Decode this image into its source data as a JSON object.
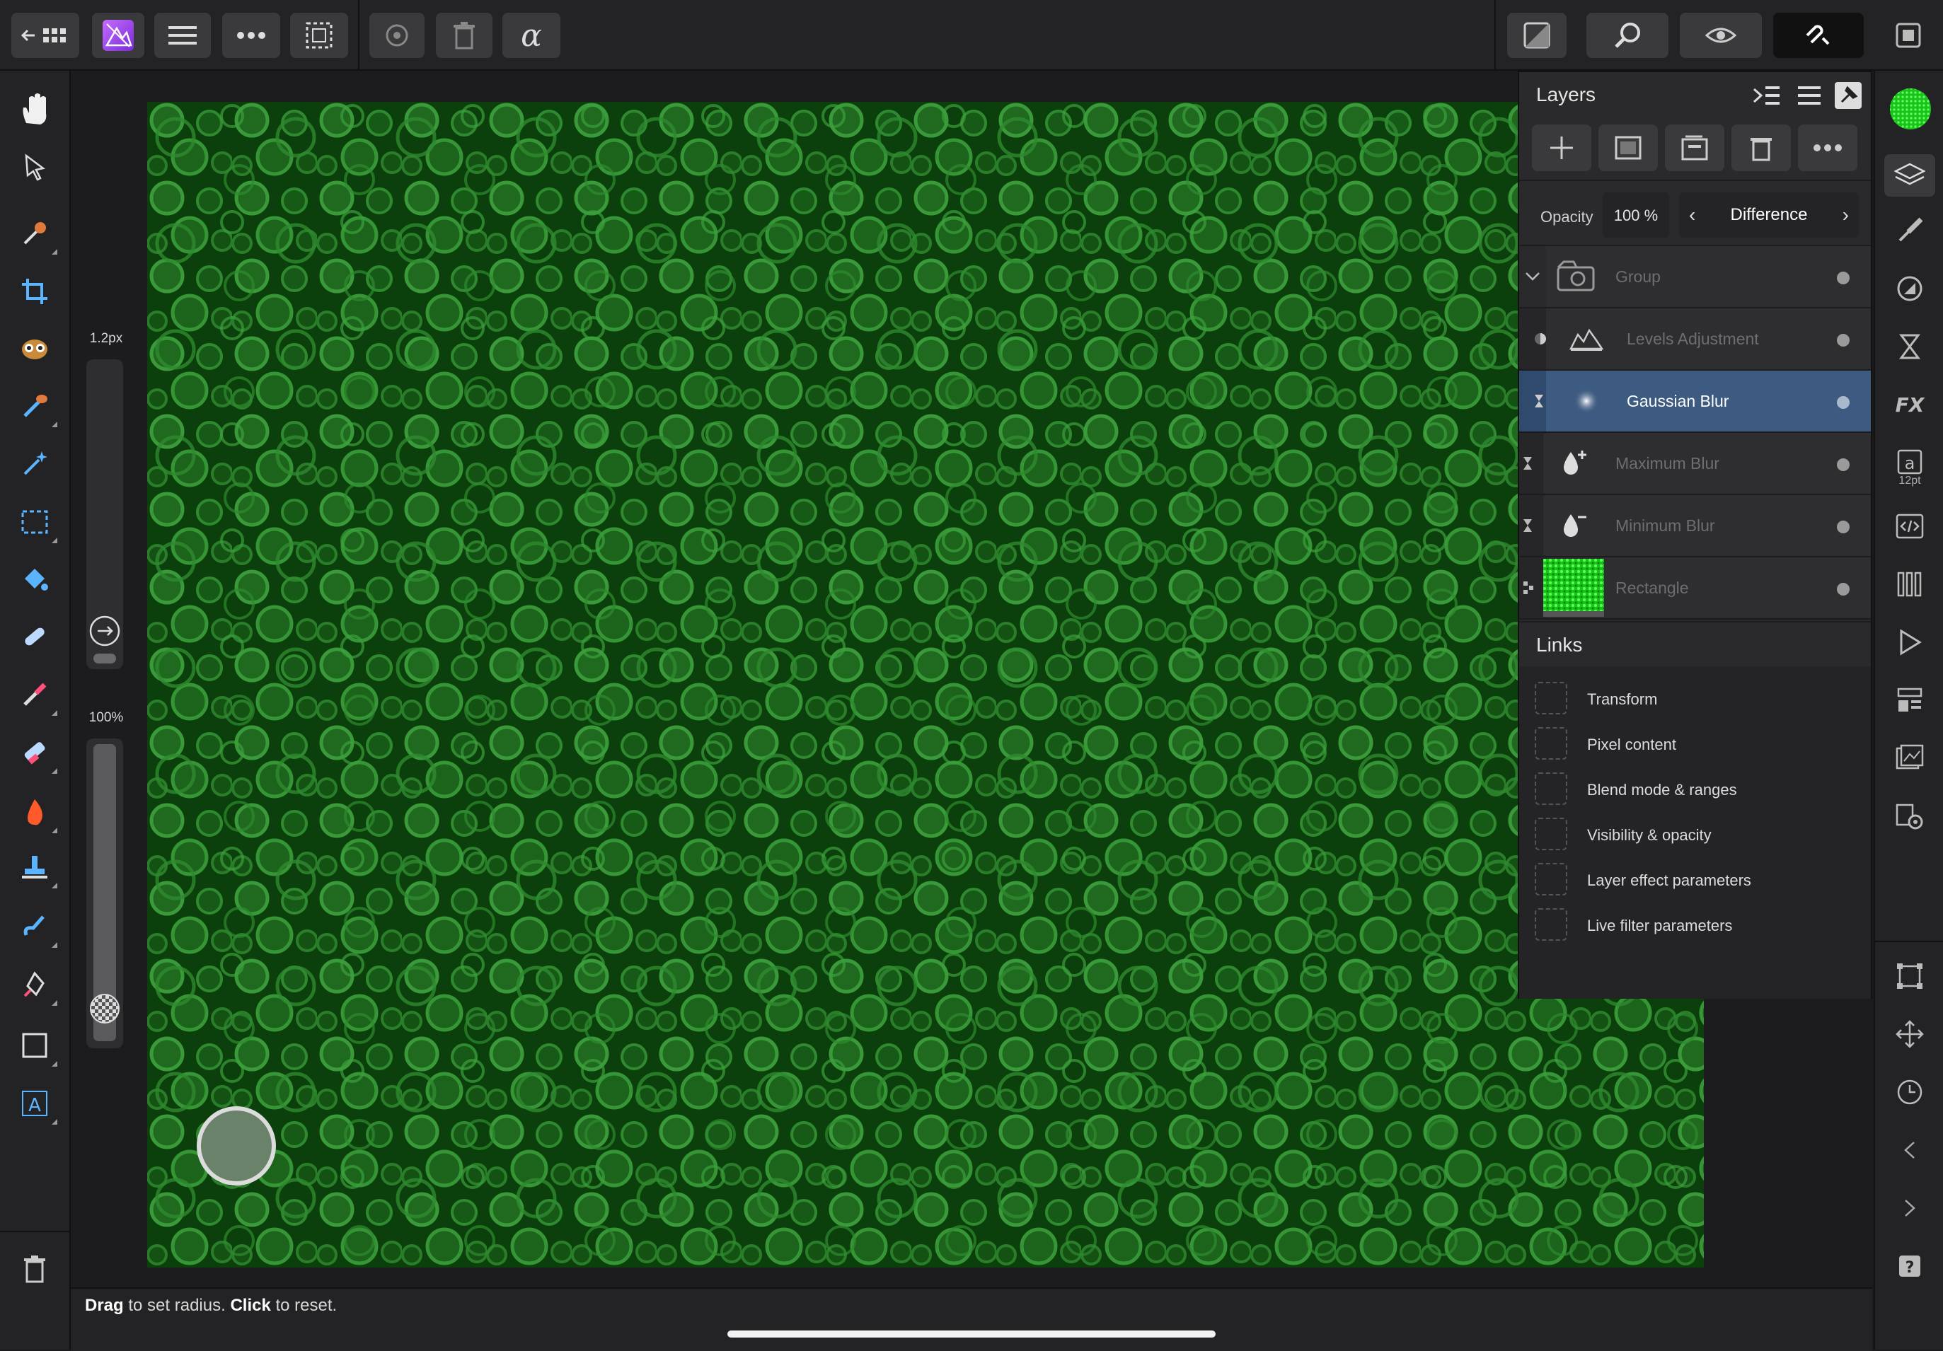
{
  "toolbar": {
    "back_icon": "back-grid-icon",
    "persona_icon": "photo-persona-icon",
    "items": [
      "menu-icon",
      "more-icon",
      "selection-icon",
      "history-icon",
      "delete-icon",
      "alpha-icon"
    ],
    "right_items": [
      "view-mode-icon",
      "zoom-icon",
      "assistant-icon",
      "snapping-icon",
      "window-icon"
    ]
  },
  "left_tools": [
    "hand-icon",
    "move-icon",
    "color-picker-icon",
    "crop-icon",
    "selection-brush-icon",
    "flood-select-icon",
    "magic-wand-icon",
    "marquee-icon",
    "fill-icon",
    "healing-brush-icon",
    "paint-brush-icon",
    "erase-brush-icon",
    "dodge-burn-icon",
    "clone-icon",
    "smudge-icon",
    "pen-icon",
    "rectangle-icon",
    "text-icon",
    "trash-icon"
  ],
  "context": {
    "radius_label": "1.2px",
    "opacity_label": "100%"
  },
  "status": {
    "drag_bold": "Drag",
    "drag_rest": " to set radius. ",
    "click_bold": "Click",
    "click_rest": " to reset."
  },
  "layers_panel": {
    "title": "Layers",
    "opacity_label": "Opacity",
    "opacity_value": "100 %",
    "blend_mode": "Difference",
    "layers": [
      {
        "name": "Group",
        "icon": "group-icon",
        "selected": false
      },
      {
        "name": "Levels Adjustment",
        "icon": "levels-icon",
        "selected": false
      },
      {
        "name": "Gaussian Blur",
        "icon": "gaussian-blur-icon",
        "selected": true
      },
      {
        "name": "Maximum Blur",
        "icon": "maximum-blur-icon",
        "selected": false
      },
      {
        "name": "Minimum Blur",
        "icon": "minimum-blur-icon",
        "selected": false
      },
      {
        "name": "Rectangle",
        "icon": "rectangle-thumbnail",
        "selected": false
      }
    ],
    "links_title": "Links",
    "links": [
      "Transform",
      "Pixel content",
      "Blend mode & ranges",
      "Visibility & opacity",
      "Layer effect parameters",
      "Live filter parameters"
    ]
  },
  "right_tools": [
    "color-swatch",
    "layers-icon",
    "brushes-icon",
    "adjustments-icon",
    "live-filters-icon",
    "fx-icon",
    "text-styles-icon",
    "code-icon",
    "swatches-icon",
    "navigator-icon",
    "stock-icon",
    "history-panel-icon",
    "settings-icon",
    "transform-icon",
    "move-panel-icon",
    "time-icon",
    "chevron-left-icon",
    "chevron-right-icon",
    "help-icon"
  ],
  "text_styles_sublabel": "12pt",
  "colors": {
    "accent_selected_row": "#3d5a80",
    "canvas_green": "#0c4a0c"
  }
}
